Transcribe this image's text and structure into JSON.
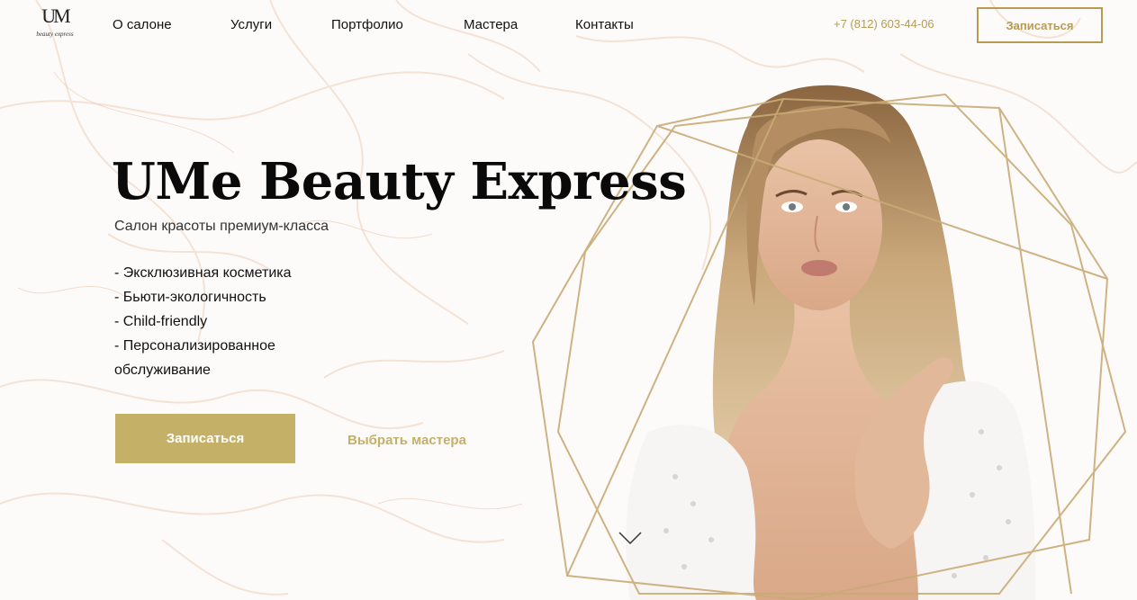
{
  "header": {
    "logo_mark": "UM",
    "logo_text": "beauty express",
    "nav": [
      "О салоне",
      "Услуги",
      "Портфолио",
      "Мастера",
      "Контакты"
    ],
    "phone": "+7 (812) 603-44-06",
    "cta": "Записаться"
  },
  "hero": {
    "title": "UMe Beauty Express",
    "subtitle": "Салон красоты премиум-класса",
    "features": [
      "- Эксклюзивная косметика",
      "- Бьюти-экологичность",
      "- Child-friendly",
      "- Персонализированное обслуживание"
    ],
    "cta_primary": "Записаться",
    "cta_secondary": "Выбрать мастера"
  },
  "colors": {
    "accent": "#c4b067",
    "accent_dark": "#b79b52",
    "text": "#111111",
    "background": "#fdfbfa"
  },
  "icons": {
    "scroll": "chevron-down-icon"
  }
}
